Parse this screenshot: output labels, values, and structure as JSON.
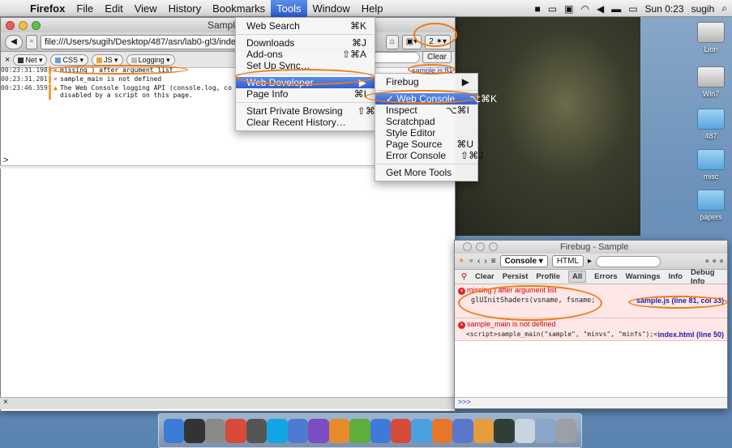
{
  "menubar": {
    "app": "Firefox",
    "items": [
      "File",
      "Edit",
      "View",
      "History",
      "Bookmarks",
      "Tools",
      "Window",
      "Help"
    ],
    "active_item": "Tools",
    "clock": "Sun 0:23",
    "user": "sugih"
  },
  "firefox": {
    "title": "Sample",
    "url": "file:///Users/sugih/Desktop/487/asn/lab0-gl3/index.h",
    "filters": [
      "Net",
      "CSS",
      "JS",
      "Logging"
    ],
    "clear_label": "Clear",
    "source_link": "sample.js:81",
    "toolbar_badge": "2",
    "log": [
      {
        "time": "00:23:31.198",
        "kind": "error",
        "msg": "missing ) after argument list"
      },
      {
        "time": "00:23:31.201",
        "kind": "error",
        "msg": "sample_main is not defined"
      },
      {
        "time": "00:23:46.359",
        "kind": "warning",
        "msg": "The Web Console logging API (console.log, co",
        "msg2": "disabled by a script on this page."
      }
    ],
    "prompt": ">",
    "status": "×"
  },
  "tools_menu": [
    {
      "label": "Web Search",
      "shortcut": "⌘K"
    },
    {
      "sep": true
    },
    {
      "label": "Downloads",
      "shortcut": "⌘J"
    },
    {
      "label": "Add-ons",
      "shortcut": "⇧⌘A"
    },
    {
      "label": "Set Up Sync…",
      "shortcut": ""
    },
    {
      "sep": true
    },
    {
      "label": "Web Developer",
      "shortcut": "▶",
      "hl": true
    },
    {
      "label": "Page Info",
      "shortcut": "⌘I"
    },
    {
      "sep": true
    },
    {
      "label": "Start Private Browsing",
      "shortcut": "⇧⌘P"
    },
    {
      "label": "Clear Recent History…",
      "shortcut": ""
    }
  ],
  "webdev_menu": [
    {
      "label": "Firebug",
      "shortcut": "▶"
    },
    {
      "sep": true
    },
    {
      "label": "✓ Web Console",
      "shortcut": "⌥⌘K",
      "hl": true
    },
    {
      "label": "Inspect",
      "shortcut": "⌥⌘I"
    },
    {
      "label": "Scratchpad",
      "shortcut": ""
    },
    {
      "label": "Style Editor",
      "shortcut": ""
    },
    {
      "label": "Page Source",
      "shortcut": "⌘U"
    },
    {
      "label": "Error Console",
      "shortcut": "⇧⌘J"
    },
    {
      "sep": true
    },
    {
      "label": "Get More Tools",
      "shortcut": ""
    }
  ],
  "firebug": {
    "title": "Firebug - Sample",
    "console_tab": "Console ▾",
    "html_tab": "HTML",
    "subbar": [
      "Clear",
      "Persist",
      "Profile",
      "All",
      "Errors",
      "Warnings",
      "Info",
      "Debug Info"
    ],
    "active_filter": "All",
    "errors": [
      {
        "msg": "missing ) after argument list",
        "code": "glUInitShaders(vsname, fsname;",
        "src": "sample.js (line 81, col 33)"
      },
      {
        "msg": "sample_main is not defined",
        "code": "<script>sample_main(\"sample\", \"minvs\", \"minfs\");<",
        "src": "index.html (line 50)"
      }
    ],
    "cmd": ">>>"
  },
  "desktop_icons": [
    {
      "label": "Lion",
      "kind": "drive"
    },
    {
      "label": "Win7",
      "kind": "drive"
    },
    {
      "label": "487",
      "kind": "folder"
    },
    {
      "label": "misc",
      "kind": "folder"
    },
    {
      "label": "papers",
      "kind": "folder"
    }
  ],
  "dock": [
    {
      "name": "finder",
      "color": "#3a7bd5"
    },
    {
      "name": "x11",
      "color": "#333333"
    },
    {
      "name": "photos",
      "color": "#8a8a8a"
    },
    {
      "name": "calendar",
      "color": "#d94a3a"
    },
    {
      "name": "facetime",
      "color": "#555555"
    },
    {
      "name": "skype",
      "color": "#12a5e6"
    },
    {
      "name": "xcode",
      "color": "#4d7bd1"
    },
    {
      "name": "orb",
      "color": "#7d4bc2"
    },
    {
      "name": "grapher",
      "color": "#e98b2a"
    },
    {
      "name": "leaf",
      "color": "#5cae3d"
    },
    {
      "name": "itunes",
      "color": "#3f7ad8"
    },
    {
      "name": "chrome",
      "color": "#d44b3b"
    },
    {
      "name": "safari",
      "color": "#4aa0e0"
    },
    {
      "name": "firefox",
      "color": "#e6762a"
    },
    {
      "name": "preview",
      "color": "#5b77c9"
    },
    {
      "name": "ibooks",
      "color": "#e59c3d"
    },
    {
      "name": "activity-monitor",
      "color": "#2f3f36"
    },
    {
      "name": "documents",
      "color": "#c9d4e0"
    },
    {
      "name": "downloads",
      "color": "#8aa6c8"
    },
    {
      "name": "trash",
      "color": "#9aa0a6"
    }
  ]
}
